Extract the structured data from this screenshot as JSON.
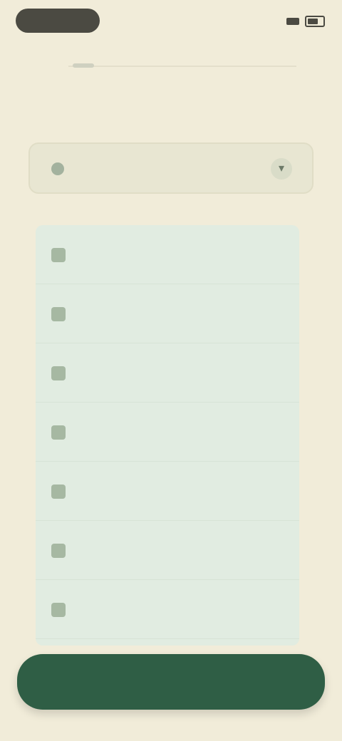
{
  "status": {
    "time": "",
    "right_text": ""
  },
  "header": {
    "title": ""
  },
  "selected": {
    "label": ""
  },
  "section": {
    "label": ""
  },
  "options": [
    {
      "label": ""
    },
    {
      "label": ""
    },
    {
      "label": ""
    },
    {
      "label": ""
    },
    {
      "label": ""
    },
    {
      "label": ""
    },
    {
      "label": ""
    }
  ],
  "actions": {
    "primary_label": ""
  },
  "colors": {
    "background": "#f1ecd9",
    "list_background": "#e1ece1",
    "primary_button": "#2f5e45",
    "status_pill": "#4b4a42"
  },
  "icons": {
    "dropdown": "chevron-down-icon",
    "signal": "signal-icon",
    "battery": "battery-icon"
  }
}
